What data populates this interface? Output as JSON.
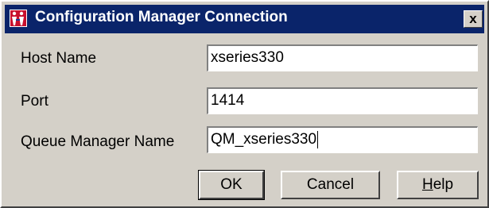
{
  "window": {
    "title": "Configuration Manager Connection",
    "close_label": "x",
    "title_bar_color": "#0a246a",
    "face_color": "#d4d0c8"
  },
  "form": {
    "host_name": {
      "label": "Host Name",
      "value": "xseries330"
    },
    "port": {
      "label": "Port",
      "value": "1414"
    },
    "queue_manager_name": {
      "label": "Queue Manager Name",
      "value": "QM_xseries330"
    }
  },
  "buttons": {
    "ok": "OK",
    "cancel": "Cancel",
    "help": "Help"
  },
  "icons": {
    "app": "configuration-manager-icon",
    "close": "close-icon"
  }
}
